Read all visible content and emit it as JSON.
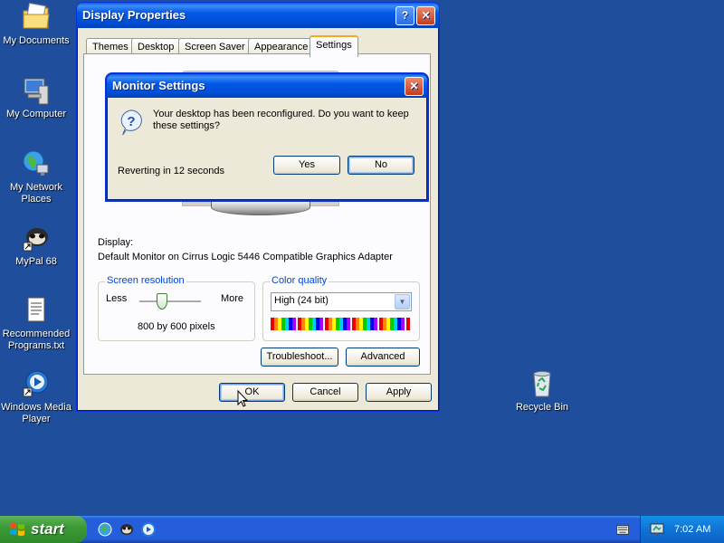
{
  "desktop": {
    "icons": [
      {
        "label": "My Documents"
      },
      {
        "label": "My Computer"
      },
      {
        "label": "My Network Places"
      },
      {
        "label": "MyPal 68"
      },
      {
        "label": "Recommended Programs.txt"
      },
      {
        "label": "Windows Media Player"
      },
      {
        "label": "Recycle Bin"
      }
    ]
  },
  "display_properties": {
    "title": "Display Properties",
    "tabs": [
      "Themes",
      "Desktop",
      "Screen Saver",
      "Appearance",
      "Settings"
    ],
    "active_tab": "Settings",
    "display_label": "Display:",
    "display_value": "Default Monitor on Cirrus Logic 5446 Compatible Graphics Adapter",
    "screen_resolution": {
      "legend": "Screen resolution",
      "less": "Less",
      "more": "More",
      "value": "800 by 600 pixels"
    },
    "color_quality": {
      "legend": "Color quality",
      "selected": "High (24 bit)"
    },
    "buttons": {
      "troubleshoot": "Troubleshoot...",
      "advanced": "Advanced",
      "ok": "OK",
      "cancel": "Cancel",
      "apply": "Apply"
    }
  },
  "monitor_dialog": {
    "title": "Monitor Settings",
    "message": "Your desktop has been reconfigured.  Do you want to keep these settings?",
    "countdown": "Reverting in 12 seconds",
    "yes": "Yes",
    "no": "No"
  },
  "taskbar": {
    "start": "start",
    "clock": "7:02 AM"
  }
}
